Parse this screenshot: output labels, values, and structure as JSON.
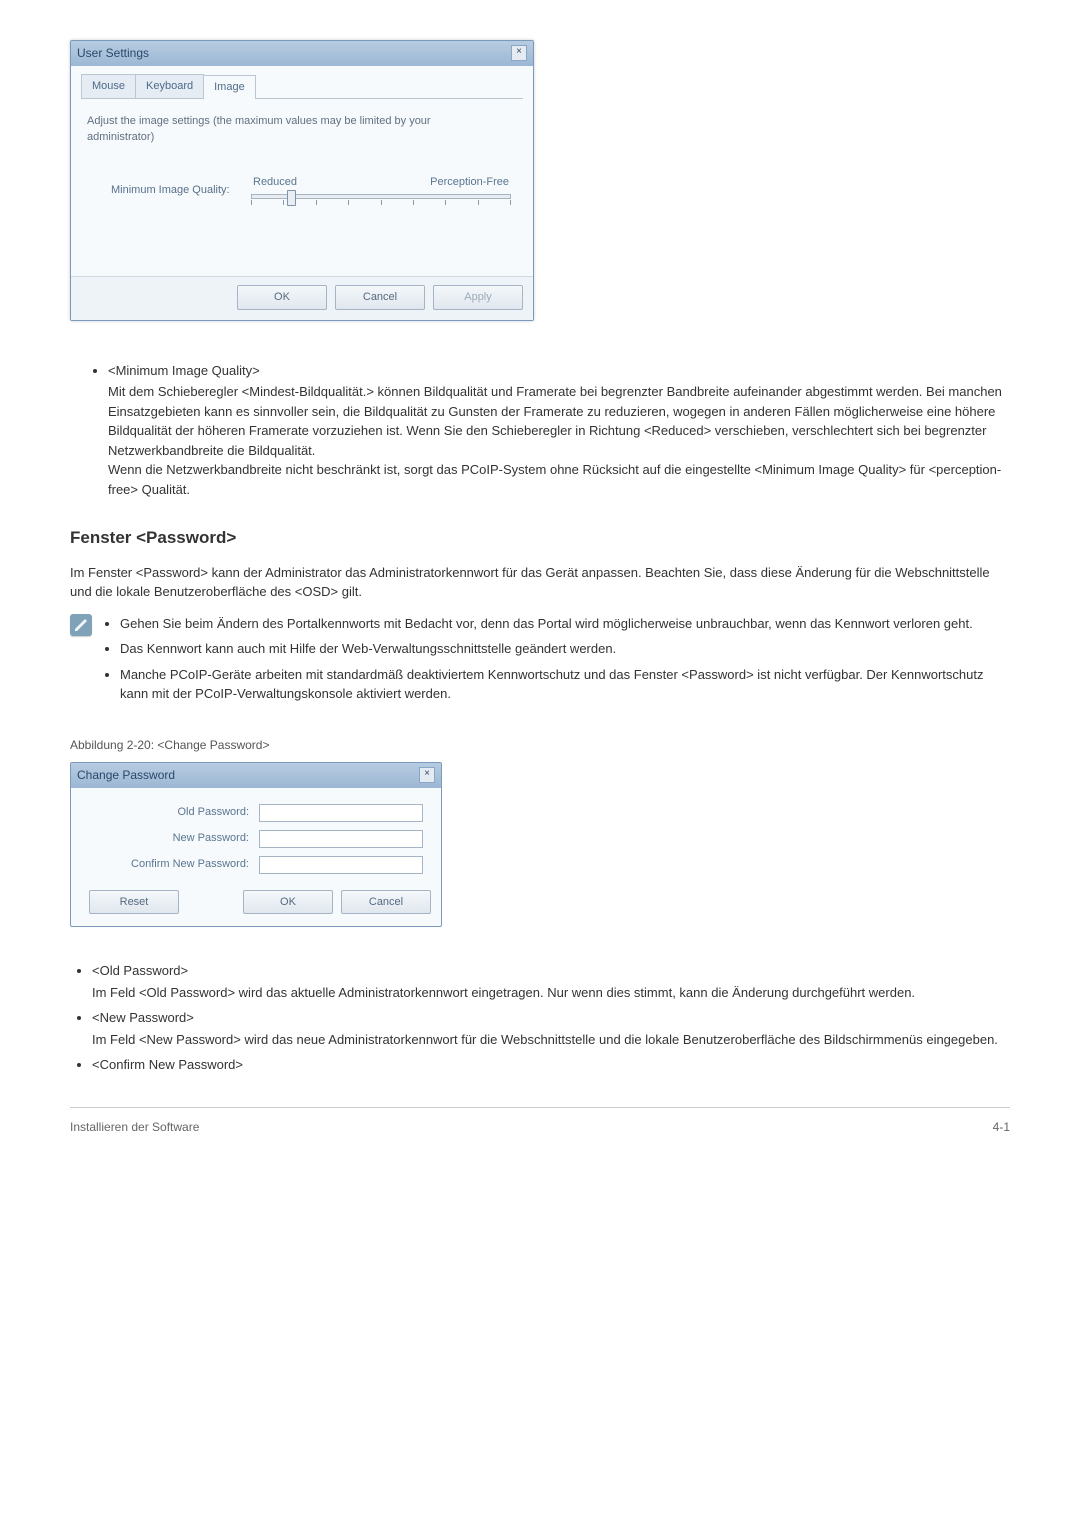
{
  "dialog1": {
    "title": "User Settings",
    "tabs": [
      "Mouse",
      "Keyboard",
      "Image"
    ],
    "active_tab": "Image",
    "note": "Adjust the image settings (the maximum values may be limited by your administrator)",
    "slider_label": "Minimum Image Quality:",
    "slider_left": "Reduced",
    "slider_right": "Perception-Free",
    "ok": "OK",
    "cancel": "Cancel",
    "apply": "Apply"
  },
  "bullets1": {
    "title": "<Minimum Image Quality>",
    "para1": "Mit dem Schieberegler <Mindest-Bildqualität.> können Bildqualität und Framerate bei begrenzter Bandbreite aufeinander abgestimmt werden. Bei manchen Einsatzgebieten kann es sinnvoller sein, die Bildqualität zu Gunsten der Framerate zu reduzieren, wogegen in anderen Fällen möglicherweise eine höhere Bildqualität der höheren Framerate vorzuziehen ist. Wenn Sie den Schieberegler in Richtung <Reduced> verschieben, verschlechtert sich bei begrenzter Netzwerkbandbreite die Bildqualität.",
    "para2": "Wenn die Netzwerkbandbreite nicht beschränkt ist, sorgt das PCoIP-System ohne Rücksicht auf die eingestellte <Minimum Image Quality> für <perception-free> Qualität."
  },
  "section_heading": "Fenster <Password>",
  "section_intro": "Im Fenster <Password> kann der Administrator das Administratorkennwort für das Gerät anpassen. Beachten Sie, dass diese Änderung für die Webschnittstelle und die lokale Benutzeroberfläche des <OSD> gilt.",
  "callout": {
    "item1": "Gehen Sie beim Ändern des Portalkennworts mit Bedacht vor, denn das Portal wird möglicherweise unbrauchbar, wenn das Kennwort verloren geht.",
    "item2": "Das Kennwort kann auch mit Hilfe der Web-Verwaltungsschnittstelle geändert werden.",
    "item3": "Manche PCoIP-Geräte arbeiten mit standardmäß deaktiviertem Kennwortschutz und das Fenster <Password> ist nicht verfügbar. Der Kennwortschutz kann mit der PCoIP-Verwaltungskonsole aktiviert werden."
  },
  "figure_caption": "Abbildung 2-20: <Change Password>",
  "dialog2": {
    "title": "Change Password",
    "old": "Old Password:",
    "new": "New Password:",
    "confirm": "Confirm New Password:",
    "reset": "Reset",
    "ok": "OK",
    "cancel": "Cancel"
  },
  "bullets2": {
    "t1": "<Old Password>",
    "b1": "Im Feld <Old Password> wird das aktuelle Administratorkennwort eingetragen. Nur wenn dies stimmt, kann die Änderung durchgeführt werden.",
    "t2": "<New Password>",
    "b2": "Im Feld <New Password> wird das neue Administratorkennwort für die Webschnittstelle und die lokale Benutzeroberfläche des Bildschirmmenüs eingegeben.",
    "t3": "<Confirm New Password>"
  },
  "footer": {
    "left": "Installieren der Software",
    "right": "4-1"
  }
}
